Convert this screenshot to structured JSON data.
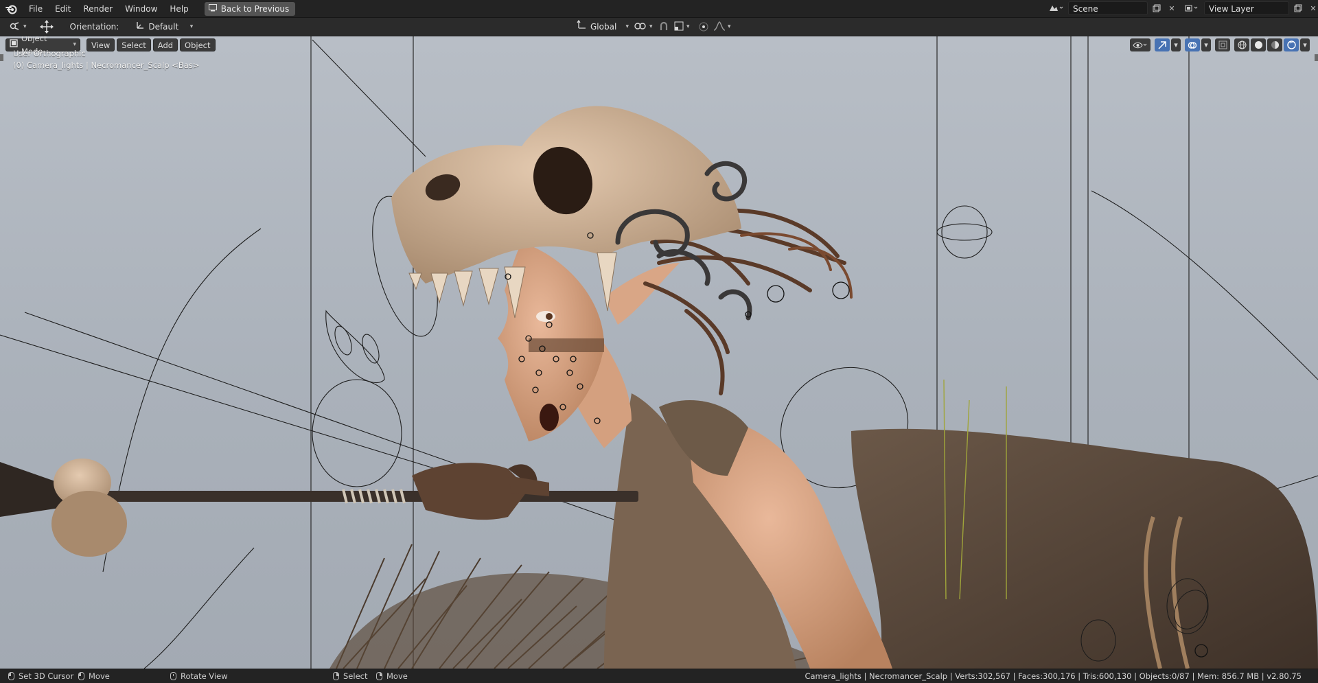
{
  "topbar": {
    "menu": [
      "File",
      "Edit",
      "Render",
      "Window",
      "Help"
    ],
    "back_button": "Back to Previous",
    "scene_name": "Scene",
    "view_layer_name": "View Layer"
  },
  "toolheader": {
    "orientation_label": "Orientation:",
    "orientation_value": "Default",
    "transform_orientation": "Global"
  },
  "viewport": {
    "mode": "Object Mode",
    "menus": [
      "View",
      "Select",
      "Add",
      "Object"
    ],
    "view_name": "User Orthographic",
    "object_info": "(0) Camera_lights | Necromancer_Scalp <Bas>"
  },
  "statusbar": {
    "left_action": "Set 3D Cursor",
    "left_action2": "Move",
    "middle_action": "Rotate View",
    "right_action": "Select",
    "right_action2": "Move",
    "stats": "Camera_lights | Necromancer_Scalp | Verts:302,567 | Faces:300,176 | Tris:600,130 | Objects:0/87 | Mem: 856.7 MB | v2.80.75"
  },
  "colors": {
    "accent": "#4772b3",
    "viewport_bg": "#aab1ba",
    "topbar_bg": "#232323"
  }
}
